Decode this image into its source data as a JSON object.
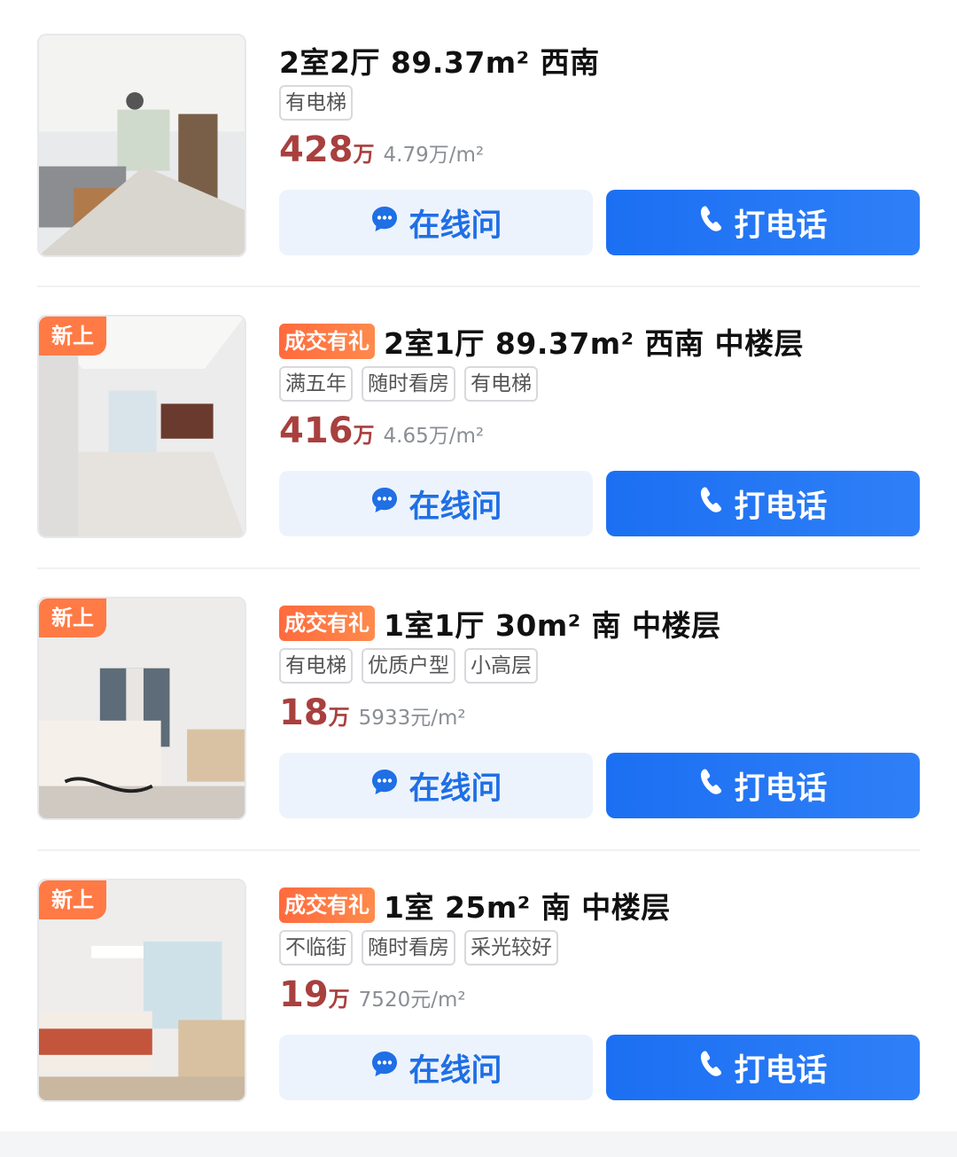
{
  "listings": [
    {
      "new_badge": "",
      "deal_badge": "",
      "title": "2室2厅 89.37m² 西南",
      "tags": [
        "有电梯"
      ],
      "price": "428",
      "price_unit": "万",
      "unit_price": "4.79万/m²",
      "chat_label": "在线问",
      "call_label": "打电话"
    },
    {
      "new_badge": "新上",
      "deal_badge": "成交有礼",
      "title": "2室1厅 89.37m² 西南 中楼层",
      "tags": [
        "满五年",
        "随时看房",
        "有电梯"
      ],
      "price": "416",
      "price_unit": "万",
      "unit_price": "4.65万/m²",
      "chat_label": "在线问",
      "call_label": "打电话"
    },
    {
      "new_badge": "新上",
      "deal_badge": "成交有礼",
      "title": "1室1厅 30m² 南 中楼层",
      "tags": [
        "有电梯",
        "优质户型",
        "小高层"
      ],
      "price": "18",
      "price_unit": "万",
      "unit_price": "5933元/m²",
      "chat_label": "在线问",
      "call_label": "打电话"
    },
    {
      "new_badge": "新上",
      "deal_badge": "成交有礼",
      "title": "1室 25m² 南 中楼层",
      "tags": [
        "不临街",
        "随时看房",
        "采光较好"
      ],
      "price": "19",
      "price_unit": "万",
      "unit_price": "7520元/m²",
      "chat_label": "在线问",
      "call_label": "打电话"
    }
  ],
  "icons": {
    "chat": "chat-bubble-icon",
    "call": "phone-icon"
  },
  "colors": {
    "price": "#a8403e",
    "primary_button": "#1b6ff2",
    "secondary_button_bg": "#edf3fc",
    "new_badge": "#ff7a45",
    "deal_badge": "#ff6a3d"
  }
}
